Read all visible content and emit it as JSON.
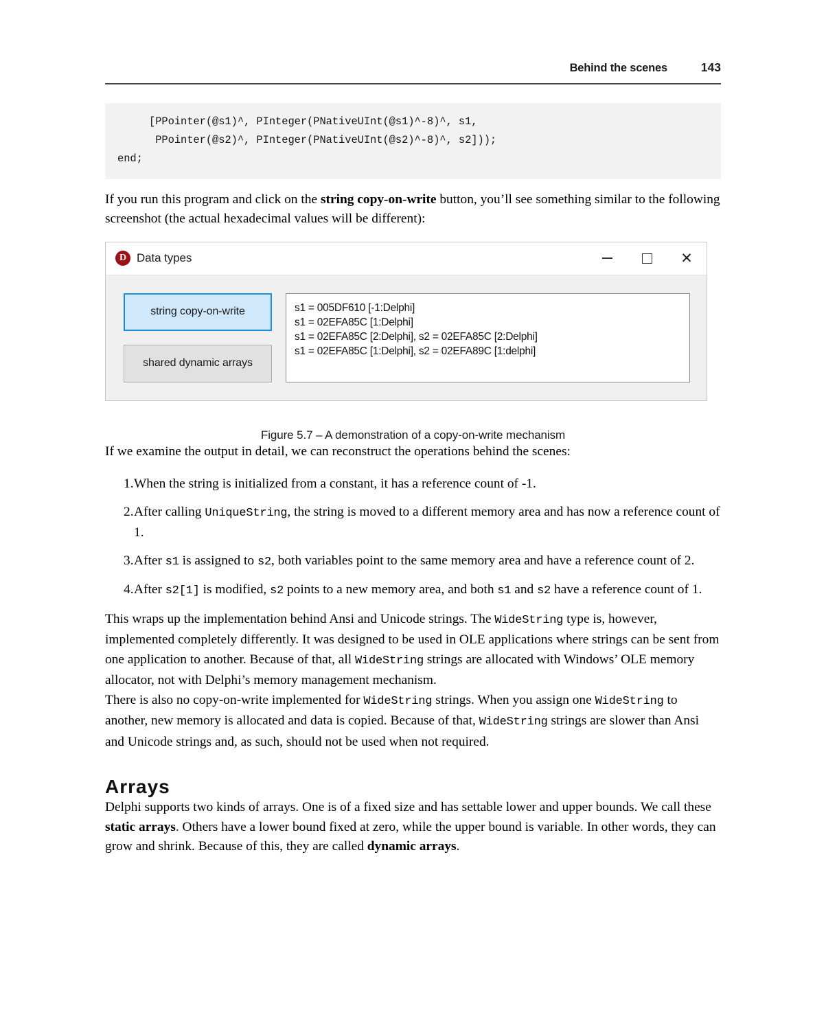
{
  "header": {
    "running_title": "Behind the scenes",
    "page_number": "143"
  },
  "code_block": {
    "text": "     [PPointer(@s1)^, PInteger(PNativeUInt(@s1)^-8)^, s1,\n      PPointer(@s2)^, PInteger(PNativeUInt(@s2)^-8)^, s2]));\nend;"
  },
  "intro_paragraph": {
    "part1": "If you run this program and click on the ",
    "bold": "string copy-on-write",
    "part2": " button, you’ll see something similar to the following screenshot (the actual hexadecimal values will be different):"
  },
  "figure": {
    "window": {
      "icon_name": "delphi-icon",
      "title": "Data types",
      "controls": {
        "minimize": "—",
        "maximize": "□",
        "close": "✕"
      },
      "buttons": [
        {
          "label": "string copy-on-write",
          "state": "focused"
        },
        {
          "label": "shared dynamic arrays",
          "state": "normal"
        }
      ],
      "output_lines": [
        "s1 = 005DF610 [-1:Delphi]",
        "s1 = 02EFA85C [1:Delphi]",
        "s1 = 02EFA85C [2:Delphi], s2 = 02EFA85C [2:Delphi]",
        "s1 = 02EFA85C [1:Delphi], s2 = 02EFA89C [1:delphi]"
      ]
    },
    "caption": "Figure 5.7 – A demonstration of a copy-on-write mechanism"
  },
  "lead_in": "If we examine the output in detail, we can reconstruct the operations behind the scenes:",
  "list": [
    {
      "number": "1.",
      "segments": [
        {
          "type": "text",
          "value": "When the string is initialized from a constant, it has a reference count of -1."
        }
      ]
    },
    {
      "number": "2.",
      "segments": [
        {
          "type": "text",
          "value": "After calling "
        },
        {
          "type": "code",
          "value": "UniqueString"
        },
        {
          "type": "text",
          "value": ", the string is moved to a different memory area and has now a reference count of 1."
        }
      ]
    },
    {
      "number": "3.",
      "segments": [
        {
          "type": "text",
          "value": "After "
        },
        {
          "type": "code",
          "value": "s1"
        },
        {
          "type": "text",
          "value": " is assigned to "
        },
        {
          "type": "code",
          "value": "s2"
        },
        {
          "type": "text",
          "value": ", both variables point to the same memory area and have a reference count of 2."
        }
      ]
    },
    {
      "number": "4.",
      "segments": [
        {
          "type": "text",
          "value": "After "
        },
        {
          "type": "code",
          "value": "s2[1]"
        },
        {
          "type": "text",
          "value": " is modified, "
        },
        {
          "type": "code",
          "value": "s2"
        },
        {
          "type": "text",
          "value": " points to a new memory area, and both "
        },
        {
          "type": "code",
          "value": "s1"
        },
        {
          "type": "text",
          "value": " and "
        },
        {
          "type": "code",
          "value": "s2"
        },
        {
          "type": "text",
          "value": " have a reference count of 1."
        }
      ]
    }
  ],
  "paragraph_widestring_1": {
    "segments": [
      {
        "type": "text",
        "value": "This wraps up the implementation behind Ansi and Unicode strings. The "
      },
      {
        "type": "code",
        "value": "WideString"
      },
      {
        "type": "text",
        "value": " type is, however, implemented completely differently. It was designed to be used in OLE applications where strings can be sent from one application to another. Because of that, all "
      },
      {
        "type": "code",
        "value": "WideString"
      },
      {
        "type": "text",
        "value": " strings are allocated with Windows’ OLE memory allocator, not with Delphi’s memory management mechanism."
      }
    ]
  },
  "paragraph_widestring_2": {
    "segments": [
      {
        "type": "text",
        "value": "There is also no copy-on-write implemented for "
      },
      {
        "type": "code",
        "value": "WideString"
      },
      {
        "type": "text",
        "value": " strings. When you assign one "
      },
      {
        "type": "code",
        "value": "WideString"
      },
      {
        "type": "text",
        "value": " to another, new memory is allocated and data is copied. Because of that, "
      },
      {
        "type": "code",
        "value": "WideString"
      },
      {
        "type": "text",
        "value": " strings are slower than Ansi and Unicode strings and, as such, should not be used when not required."
      }
    ]
  },
  "arrays_section": {
    "heading": "Arrays",
    "paragraph": {
      "segments": [
        {
          "type": "text",
          "value": "Delphi supports two kinds of arrays. One is of a fixed size and has settable lower and upper bounds. We call these "
        },
        {
          "type": "bold",
          "value": "static arrays"
        },
        {
          "type": "text",
          "value": ". Others have a lower bound fixed at zero, while the upper bound is variable. In other words, they can grow and shrink. Because of this, they are called "
        },
        {
          "type": "bold",
          "value": "dynamic arrays"
        },
        {
          "type": "text",
          "value": "."
        }
      ]
    }
  },
  "colors": {
    "code_background": "#f2f2f2",
    "dialog_body": "#f0f0f0",
    "focused_button_fill": "#cfe8fb",
    "focused_button_border": "#1a8fe0",
    "normal_button_fill": "#e1e1e1",
    "delphi_icon": "#9c1016",
    "rule": "#444444"
  }
}
